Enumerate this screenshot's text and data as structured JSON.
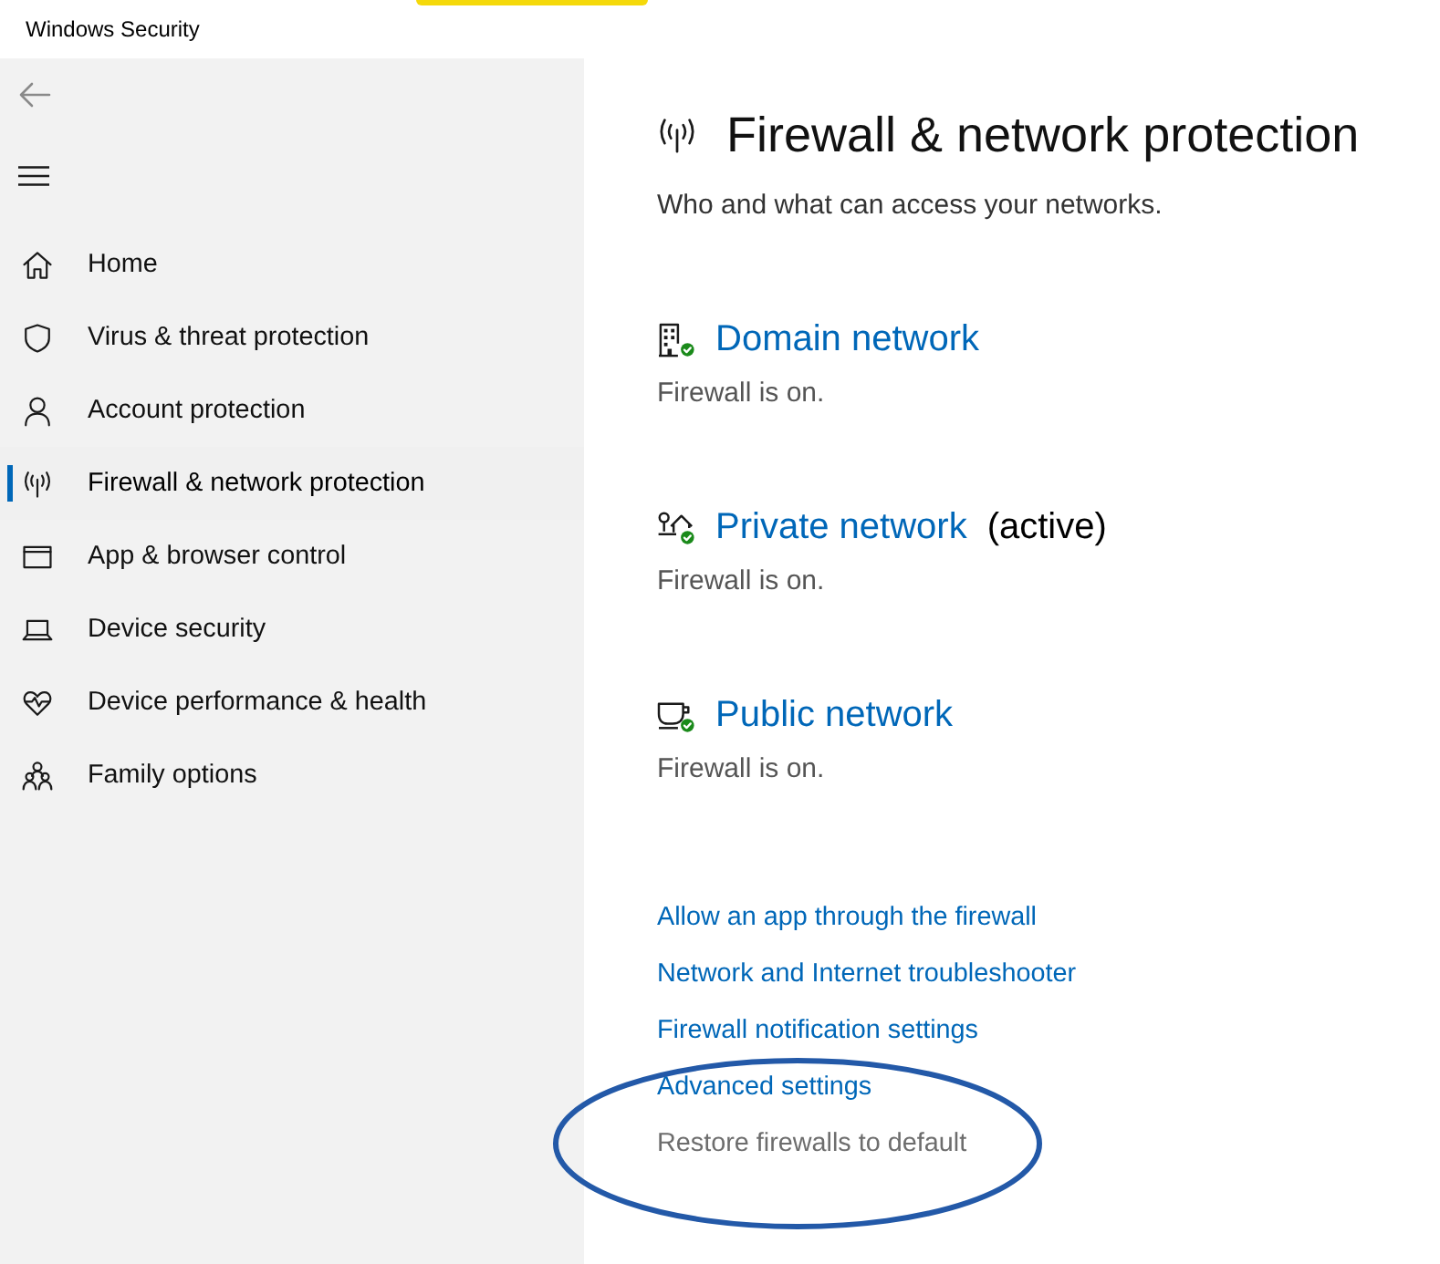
{
  "window": {
    "title": "Windows Security"
  },
  "sidebar": {
    "items": [
      {
        "kind": "home",
        "label": "Home",
        "selected": false
      },
      {
        "kind": "shield",
        "label": "Virus & threat protection",
        "selected": false
      },
      {
        "kind": "person",
        "label": "Account protection",
        "selected": false
      },
      {
        "kind": "antenna",
        "label": "Firewall & network protection",
        "selected": true
      },
      {
        "kind": "window",
        "label": "App & browser control",
        "selected": false
      },
      {
        "kind": "laptop",
        "label": "Device security",
        "selected": false
      },
      {
        "kind": "heart",
        "label": "Device performance & health",
        "selected": false
      },
      {
        "kind": "family",
        "label": "Family options",
        "selected": false
      }
    ]
  },
  "page": {
    "title": "Firewall & network protection",
    "subtitle": "Who and what can access your networks."
  },
  "networks": [
    {
      "kind": "domain",
      "name": "Domain network",
      "status": "Firewall is on."
    },
    {
      "kind": "private",
      "name": "Private network",
      "tag": "(active)",
      "status": "Firewall is on."
    },
    {
      "kind": "public",
      "name": "Public network",
      "status": "Firewall is on."
    }
  ],
  "links": [
    {
      "label": "Allow an app through the firewall",
      "disabled": false,
      "circled": false
    },
    {
      "label": "Network and Internet troubleshooter",
      "disabled": false,
      "circled": false
    },
    {
      "label": "Firewall notification settings",
      "disabled": false,
      "circled": false
    },
    {
      "label": "Advanced settings",
      "disabled": false,
      "circled": false
    },
    {
      "label": "Restore firewalls to default",
      "disabled": true,
      "circled": true
    }
  ]
}
